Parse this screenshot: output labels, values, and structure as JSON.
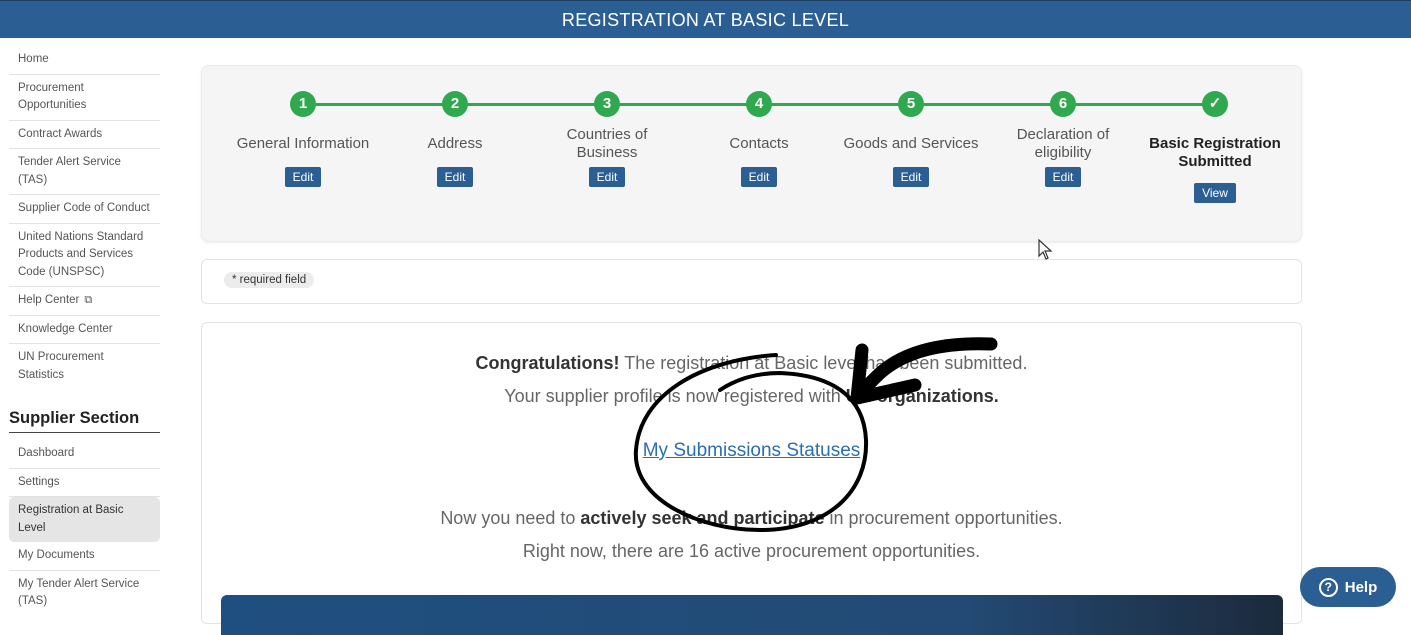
{
  "header": {
    "title": "REGISTRATION AT BASIC LEVEL"
  },
  "sidebar": {
    "items_top": [
      {
        "label": "Home"
      },
      {
        "label": "Procurement Opportunities"
      },
      {
        "label": "Contract Awards"
      },
      {
        "label": "Tender Alert Service (TAS)"
      },
      {
        "label": "Supplier Code of Conduct"
      },
      {
        "label": "United Nations Standard Products and Services Code (UNSPSC)"
      },
      {
        "label": "Help Center",
        "icon": "external-link-icon"
      },
      {
        "label": "Knowledge Center"
      },
      {
        "label": "UN Procurement Statistics"
      }
    ],
    "section_title": "Supplier Section",
    "items_section": [
      {
        "label": "Dashboard"
      },
      {
        "label": "Settings"
      },
      {
        "label": "Registration at Basic Level",
        "active": true
      },
      {
        "label": "My Documents"
      },
      {
        "label": "My Tender Alert Service (TAS)"
      }
    ]
  },
  "steps": [
    {
      "number": "1",
      "label": "General Information",
      "button": "Edit"
    },
    {
      "number": "2",
      "label": "Address",
      "button": "Edit"
    },
    {
      "number": "3",
      "label": "Countries of Business",
      "button": "Edit"
    },
    {
      "number": "4",
      "label": "Contacts",
      "button": "Edit"
    },
    {
      "number": "5",
      "label": "Goods and Services",
      "button": "Edit"
    },
    {
      "number": "6",
      "label": "Declaration of eligibility",
      "button": "Edit"
    },
    {
      "number": "✓",
      "label": "Basic Registration Submitted",
      "button": "View"
    }
  ],
  "required_note": "* required field",
  "message": {
    "congrats_bold": "Congratulations!",
    "congrats_rest": " The registration at Basic level has been submitted.",
    "profile_start": "Your supplier profile is now registered with ",
    "profile_bold": "UN organizations.",
    "link": "My Submissions Statuses",
    "need_start": "Now you need to ",
    "need_bold": "actively seek and participate",
    "need_end": " in procurement opportunities.",
    "active_count": "Right now, there are 16 active procurement opportunities."
  },
  "help_button": "Help",
  "colors": {
    "brand": "#2b5f93",
    "step_green": "#2fa84f",
    "link": "#2a6fb0"
  }
}
